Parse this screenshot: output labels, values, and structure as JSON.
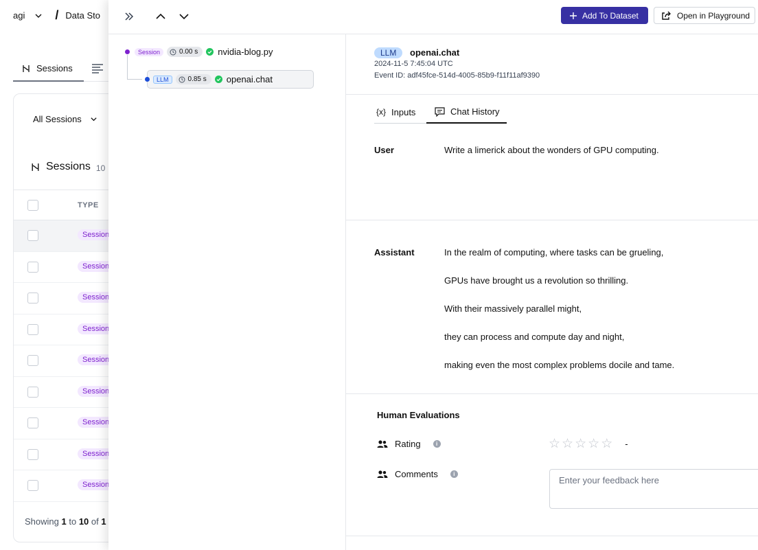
{
  "background": {
    "breadcrumb": {
      "org": "agi",
      "project": "Data Sto"
    },
    "tabs": [
      {
        "label": "Sessions"
      }
    ],
    "filter": {
      "label": "All Sessions"
    },
    "sessions_title": "Sessions",
    "sessions_count": "10",
    "table": {
      "header_type": "TYPE",
      "rows": [
        {
          "type": "Session"
        },
        {
          "type": "Session"
        },
        {
          "type": "Session"
        },
        {
          "type": "Session"
        },
        {
          "type": "Session"
        },
        {
          "type": "Session"
        },
        {
          "type": "Session"
        },
        {
          "type": "Session"
        },
        {
          "type": "Session"
        }
      ]
    },
    "footer": {
      "prefix": "Showing",
      "from": "1",
      "to_word": "to",
      "to": "10",
      "of_word": "of",
      "total": "1"
    }
  },
  "toolbar": {
    "add_to_dataset": "Add To Dataset",
    "open_in_playground": "Open in Playground"
  },
  "trace": {
    "root": {
      "badge": "Session",
      "duration": "0.00 s",
      "name": "nvidia-blog.py",
      "status": "success"
    },
    "child": {
      "badge": "LLM",
      "duration": "0.85 s",
      "name": "openai.chat",
      "status": "success"
    }
  },
  "event": {
    "type_badge": "LLM",
    "name": "openai.chat",
    "timestamp": "2024-11-5 7:45:04 UTC",
    "event_id": "Event ID: adf45fce-514d-4005-85b9-f11f11af9390"
  },
  "detail_tabs": {
    "inputs": "Inputs",
    "inputs_icon": "{x}",
    "chat_history": "Chat History"
  },
  "chat": {
    "user_role": "User",
    "user_text": "Write a limerick about the wonders of GPU computing.",
    "assistant_role": "Assistant",
    "assistant_lines": [
      "In the realm of computing, where tasks can be grueling,",
      "GPUs have brought us a revolution so thrilling.",
      "With their massively parallel might,",
      "they can process and compute day and night,",
      "making even the most complex problems docile and tame."
    ]
  },
  "evaluations": {
    "title": "Human Evaluations",
    "rating_label": "Rating",
    "rating_value": "-",
    "rating_stars_filled": 0,
    "rating_stars_total": 5,
    "comments_label": "Comments",
    "comments_placeholder": "Enter your feedback here"
  },
  "colors": {
    "primary": "#3730a3",
    "session_purple": "#7e22ce",
    "llm_blue": "#1d4ed8",
    "success_green": "#22c55e"
  }
}
